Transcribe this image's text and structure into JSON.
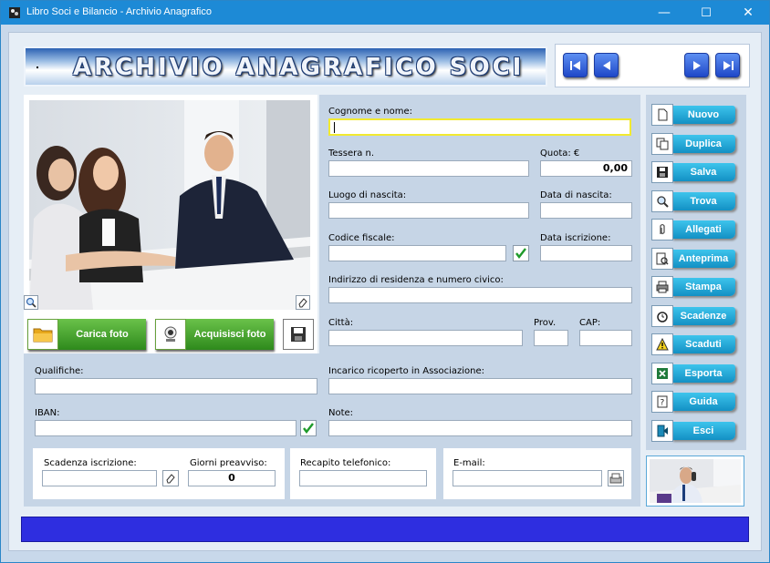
{
  "window": {
    "title": "Libro Soci e Bilancio - Archivio Anagrafico",
    "minimize_glyph": "—",
    "maximize_glyph": "☐",
    "close_glyph": "✕"
  },
  "banner": {
    "title": "ARCHIVIO ANAGRAFICO SOCI"
  },
  "form": {
    "cognome_label": "Cognome e nome:",
    "cognome_value": "",
    "tessera_label": "Tessera n.",
    "tessera_value": "",
    "quota_label": "Quota: €",
    "quota_value": "0,00",
    "luogo_label": "Luogo di nascita:",
    "luogo_value": "",
    "data_nascita_label": "Data di nascita:",
    "data_nascita_value": "",
    "codice_label": "Codice fiscale:",
    "codice_value": "",
    "data_iscrizione_label": "Data iscrizione:",
    "data_iscrizione_value": "",
    "indirizzo_label": "Indirizzo di residenza e numero civico:",
    "indirizzo_value": "",
    "citta_label": "Città:",
    "citta_value": "",
    "prov_label": "Prov.",
    "prov_value": "",
    "cap_label": "CAP:",
    "cap_value": "",
    "qualifiche_label": "Qualifiche:",
    "qualifiche_value": "",
    "incarico_label": "Incarico ricoperto in Associazione:",
    "incarico_value": "",
    "iban_label": "IBAN:",
    "iban_value": "",
    "note_label": "Note:",
    "note_value": "",
    "scadenza_label": "Scadenza iscrizione:",
    "scadenza_value": "",
    "giorni_label": "Giorni preavviso:",
    "giorni_value": "0",
    "recapito_label": "Recapito telefonico:",
    "recapito_value": "",
    "email_label": "E-mail:",
    "email_value": ""
  },
  "photo": {
    "carica_label": "Carica foto",
    "acquisisci_label": "Acquisisci foto"
  },
  "side_buttons": [
    {
      "label": "Nuovo",
      "icon": "new-document-icon"
    },
    {
      "label": "Duplica",
      "icon": "copy-icon"
    },
    {
      "label": "Salva",
      "icon": "floppy-icon"
    },
    {
      "label": "Trova",
      "icon": "magnifier-icon"
    },
    {
      "label": "Allegati",
      "icon": "paperclip-icon"
    },
    {
      "label": "Anteprima",
      "icon": "preview-icon"
    },
    {
      "label": "Stampa",
      "icon": "printer-icon"
    },
    {
      "label": "Scadenze",
      "icon": "alarm-clock-icon"
    },
    {
      "label": "Scaduti",
      "icon": "warning-icon"
    },
    {
      "label": "Esporta",
      "icon": "excel-icon"
    },
    {
      "label": "Guida",
      "icon": "help-icon"
    },
    {
      "label": "Esci",
      "icon": "exit-icon"
    }
  ],
  "colors": {
    "titlebar": "#1d8ad6",
    "accent_blue": "#1390c4",
    "green_button": "#2e8a1c",
    "status_bar": "#2e2ee0"
  }
}
